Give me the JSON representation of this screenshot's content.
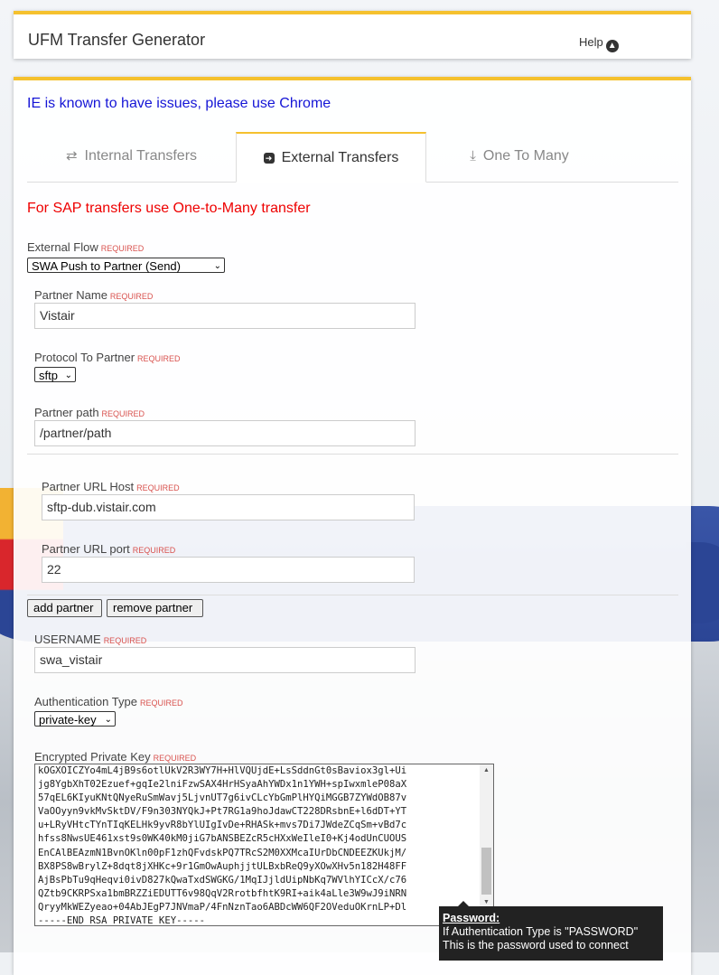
{
  "header": {
    "title": "UFM Transfer Generator",
    "help_label": "Help",
    "help_icon": "chevron-up-circle-icon"
  },
  "warnings": {
    "ie": "IE is known to have issues, please use Chrome",
    "sap": "For SAP transfers use One-to-Many transfer"
  },
  "tabs": [
    {
      "label": "Internal Transfers",
      "icon": "retweet-icon",
      "active": false
    },
    {
      "label": "External Transfers",
      "icon": "share-square-icon",
      "active": true
    },
    {
      "label": "One To Many",
      "icon": "download-icon",
      "active": false
    }
  ],
  "required_tag": "REQUIRED",
  "form": {
    "external_flow": {
      "label": "External Flow",
      "value": "SWA Push to Partner (Send)"
    },
    "partner_name": {
      "label": "Partner Name",
      "value": "Vistair"
    },
    "protocol": {
      "label": "Protocol To Partner",
      "value": "sftp"
    },
    "partner_path": {
      "label": "Partner path",
      "value": "/partner/path"
    },
    "url_host": {
      "label": "Partner URL Host",
      "value": "sftp-dub.vistair.com"
    },
    "url_port": {
      "label": "Partner URL port",
      "value": "22"
    },
    "add_partner": "add partner",
    "remove_partner": "remove partner",
    "username": {
      "label": "USERNAME",
      "value": "swa_vistair"
    },
    "auth_type": {
      "label": "Authentication Type",
      "value": "private-key"
    },
    "private_key": {
      "label": "Encrypted Private Key",
      "lines": "kOGXOICZYo4mL4jB9s6otlUkV2R3WY7H+HlVQUjdE+LsSddnGt0sBaviox3gl+Ui\njg8YgbXhT02Ezuef+gqIe2lniFzwSAX4HrHSyaAhYWDx1n1YWH+spIwxmleP08aX\n57qEL6KIyuKNtQNyeRuSmWavj5LjvnUT7g6ivCLcYbGmPlHYQiMGGB7ZYWdOB87v\nVaOOyyn9vkMvSktDV/F9n303NYQkJ+Pt7RG1a9hoJdawCT228DRsbnE+l6dDT+YT\nu+LRyVHtcTYnTIqKELHk9yvR8bYlUIgIvDe+RHASk+mvs7Di7JWdeZCqSm+vBd7c\nhfss8NwsUE461xst9s0WK40kM0jiG7bANSBEZcR5cHXxWeIleI0+Kj4odUnCUOUS\nEnCAlBEAzmN1BvnOKln00pF1zhQFvdskPQ7TRcS2M0XXMcaIUrDbCNDEEZKUkjM/\nBX8PS8wBrylZ+8dqt8jXHKc+9r1GmOwAuphjjtULBxbReQ9yXOwXHv5n182H48FF\nAjBsPbTu9qHeqvi0ivD827kQwaTxdSWGKG/1MqIJjldUipNbKq7WVlhYICcX/c76\nQZtb9CKRPSxa1bmBRZZiEDUTT6v98QqV2RrotbfhtK9RI+aik4aLle3W9wJ9iNRN\nQryyMkWEZyeao+04AbJEgP7JNVmaP/4FnNznTao6ABDcWW6QF2OVeduOKrnLP+Dl\n-----END RSA PRIVATE KEY-----"
    }
  },
  "tooltip": {
    "title": "Password:",
    "line1": "If Authentication Type is \"PASSWORD\"",
    "line2": "This is the password used to connect"
  },
  "colors": {
    "accent": "#f5c12e",
    "warning_blue": "#1515d6",
    "warning_red": "#e00000",
    "required": "#d9534f"
  }
}
